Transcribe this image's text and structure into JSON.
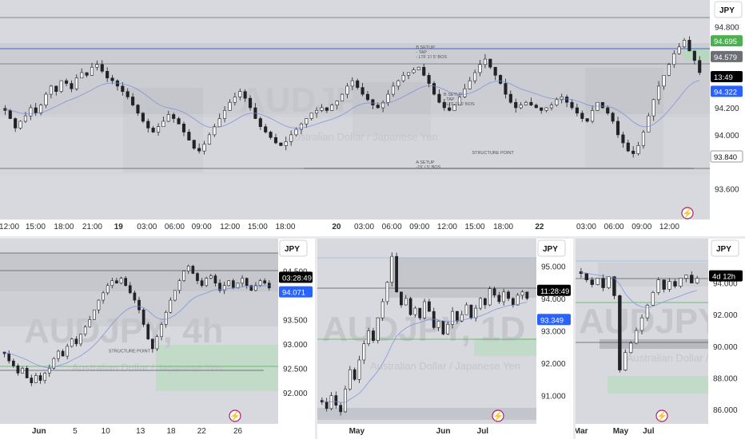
{
  "colors": {
    "up": "#ffffff",
    "down": "#202226",
    "blue_line": "#5b7bd6",
    "price_blue": "#2962ff",
    "green_tag": "#4caf50",
    "grey_tag": "#6b6e75",
    "black_tag": "#000000",
    "accent": "#b0206e",
    "green_zone": "#b9dcc0",
    "grey_zone": "#bcbec4"
  },
  "icons": [
    "lightning-icon"
  ],
  "panes": [
    {
      "id": "p1",
      "currency": "JPY",
      "watermark": "AUDJPY",
      "watermark_sub": "Australian Dollar / Japanese Yen",
      "chart_data": {
        "type": "candlestick",
        "ylim": [
          93.45,
          94.95
        ],
        "y_ticks": [
          {
            "v": 94.8,
            "t": "94.800"
          },
          {
            "v": 94.6,
            "t": "94.600"
          },
          {
            "v": 94.2,
            "t": "94.200"
          },
          {
            "v": 94.0,
            "t": "94.000"
          },
          {
            "v": 93.84,
            "t": "93.840"
          },
          {
            "v": 93.6,
            "t": "93.600"
          }
        ],
        "x_ticks": [
          {
            "x": 0.013,
            "t": "12:00"
          },
          {
            "x": 0.05,
            "t": "15:00"
          },
          {
            "x": 0.09,
            "t": "18:00"
          },
          {
            "x": 0.13,
            "t": "21:00"
          },
          {
            "x": 0.167,
            "t": "19",
            "bold": true
          },
          {
            "x": 0.207,
            "t": "03:00"
          },
          {
            "x": 0.246,
            "t": "06:00"
          },
          {
            "x": 0.284,
            "t": "09:00"
          },
          {
            "x": 0.324,
            "t": "12:00"
          },
          {
            "x": 0.363,
            "t": "15:00"
          },
          {
            "x": 0.402,
            "t": "18:00"
          },
          {
            "x": 0.474,
            "t": "20",
            "bold": true
          },
          {
            "x": 0.513,
            "t": "03:00"
          },
          {
            "x": 0.552,
            "t": "06:00"
          },
          {
            "x": 0.591,
            "t": "09:00"
          },
          {
            "x": 0.63,
            "t": "12:00"
          },
          {
            "x": 0.669,
            "t": "15:00"
          },
          {
            "x": 0.709,
            "t": "18:00"
          },
          {
            "x": 0.76,
            "t": "22",
            "bold": true
          },
          {
            "x": 0.826,
            "t": "03:00"
          },
          {
            "x": 0.865,
            "t": "06:00"
          },
          {
            "x": 0.904,
            "t": "09:00"
          },
          {
            "x": 0.943,
            "t": "12:00"
          }
        ],
        "close": [
          94.18,
          94.12,
          94.05,
          94.1,
          94.14,
          94.2,
          94.16,
          94.22,
          94.3,
          94.36,
          94.32,
          94.4,
          94.38,
          94.34,
          94.42,
          94.46,
          94.44,
          94.5,
          94.52,
          94.47,
          94.42,
          94.4,
          94.36,
          94.32,
          94.28,
          94.22,
          94.16,
          94.1,
          94.05,
          94.02,
          94.06,
          94.1,
          94.15,
          94.12,
          94.08,
          94.02,
          93.96,
          93.9,
          93.88,
          93.93,
          94.0,
          94.06,
          94.12,
          94.18,
          94.24,
          94.28,
          94.32,
          94.27,
          94.2,
          94.12,
          94.06,
          94.02,
          93.98,
          93.94,
          93.92,
          93.95,
          94.0,
          94.04,
          94.08,
          94.12,
          94.16,
          94.18,
          94.2,
          94.18,
          94.22,
          94.25,
          94.3,
          94.36,
          94.4,
          94.35,
          94.3,
          94.26,
          94.22,
          94.2,
          94.24,
          94.3,
          94.36,
          94.4,
          94.44,
          94.46,
          94.48,
          94.5,
          94.44,
          94.38,
          94.3,
          94.24,
          94.2,
          94.18,
          94.22,
          94.28,
          94.34,
          94.4,
          94.46,
          94.52,
          94.56,
          94.5,
          94.44,
          94.38,
          94.3,
          94.24,
          94.2,
          94.22,
          94.24,
          94.22,
          94.2,
          94.18,
          94.2,
          94.22,
          94.26,
          94.28,
          94.24,
          94.2,
          94.16,
          94.12,
          94.1,
          94.18,
          94.24,
          94.2,
          94.16,
          94.1,
          94.0,
          93.94,
          93.88,
          93.86,
          93.92,
          94.02,
          94.14,
          94.26,
          94.36,
          94.44,
          94.52,
          94.6,
          94.65,
          94.7,
          94.62,
          94.55,
          94.46
        ],
        "tag_prices": {
          "upper_green": 94.695,
          "current_grey": 94.579,
          "countdown": 94.43,
          "blue": 94.322,
          "support": 93.84
        },
        "tag_texts": {
          "upper_green": "94.695",
          "current_grey": "94.579",
          "countdown": "13:49",
          "blue": "94.322",
          "support": "93.840"
        },
        "annotations": [
          {
            "lines": [
              "B SETUP",
              "- TAP",
              "- LTF 1'/ 5' BOS"
            ],
            "x": 0.586,
            "y": 94.62
          },
          {
            "lines": [
              "B SETUP",
              "- TAP",
              "- LTF 1'/ 5' BOS"
            ],
            "x": 0.625,
            "y": 94.27
          },
          {
            "lines": [
              "STRUCTURE POINT"
            ],
            "x": 0.665,
            "y": 93.84
          },
          {
            "lines": [
              "A SETUP",
              "-15' / 5' BOS"
            ],
            "x": 0.586,
            "y": 93.77
          }
        ]
      }
    },
    {
      "id": "p2",
      "currency": "JPY",
      "watermark": "AUDJPY, 4h",
      "watermark_sub": "Australian Dollar / Japanese Yen",
      "chart_data": {
        "type": "candlestick",
        "ylim": [
          91.8,
          95.0
        ],
        "y_ticks": [
          {
            "v": 94.5,
            "t": "94.500"
          },
          {
            "v": 93.5,
            "t": "93.500"
          },
          {
            "v": 93.0,
            "t": "93.000"
          },
          {
            "v": 92.5,
            "t": "92.500"
          },
          {
            "v": 92.0,
            "t": "92.000"
          }
        ],
        "x_ticks": [
          {
            "x": 0.14,
            "t": "Jun",
            "bold": true
          },
          {
            "x": 0.27,
            "t": "5"
          },
          {
            "x": 0.38,
            "t": "10"
          },
          {
            "x": 0.505,
            "t": "13"
          },
          {
            "x": 0.615,
            "t": "18"
          },
          {
            "x": 0.725,
            "t": "22"
          },
          {
            "x": 0.855,
            "t": "26"
          }
        ],
        "close": [
          92.8,
          92.65,
          92.55,
          92.4,
          92.5,
          92.3,
          92.2,
          92.35,
          92.25,
          92.4,
          92.5,
          92.7,
          92.85,
          92.75,
          92.95,
          93.1,
          93.0,
          93.2,
          93.35,
          93.5,
          93.7,
          93.9,
          94.05,
          94.2,
          94.3,
          94.25,
          94.35,
          94.2,
          94.05,
          93.9,
          93.7,
          93.4,
          93.1,
          92.9,
          93.15,
          93.4,
          93.65,
          93.9,
          94.1,
          94.3,
          94.5,
          94.6,
          94.45,
          94.3,
          94.2,
          94.35,
          94.4,
          94.25,
          94.1,
          94.2,
          94.3,
          94.15,
          94.25,
          94.35,
          94.2,
          94.1,
          94.2,
          94.3,
          94.25,
          94.15
        ],
        "tag_texts": {
          "countdown": "03:28:49",
          "blue": "94.071"
        },
        "tag_prices": {
          "countdown": 94.37,
          "blue": 94.07
        },
        "annotations": [
          {
            "lines": [
              "STRUCTURE POINT"
            ],
            "x": 0.39,
            "y": 92.78
          }
        ]
      }
    },
    {
      "id": "p3",
      "currency": "JPY",
      "watermark": "AUDJPY, 1D",
      "watermark_sub": "Australian Dollar / Japanese Yen",
      "chart_data": {
        "type": "candlestick",
        "ylim": [
          90.3,
          95.6
        ],
        "y_ticks": [
          {
            "v": 95.0,
            "t": "95.000"
          },
          {
            "v": 94.0,
            "t": "94.000"
          },
          {
            "v": 93.0,
            "t": "93.000"
          },
          {
            "v": 92.0,
            "t": "92.000"
          },
          {
            "v": 91.0,
            "t": "91.000"
          }
        ],
        "x_ticks": [
          {
            "x": 0.18,
            "t": "May",
            "bold": true
          },
          {
            "x": 0.575,
            "t": "Jun",
            "bold": true
          },
          {
            "x": 0.755,
            "t": "Jul",
            "bold": true
          }
        ],
        "close": [
          90.8,
          90.6,
          91.0,
          90.7,
          90.5,
          91.2,
          91.8,
          91.5,
          92.1,
          92.6,
          93.0,
          92.7,
          93.4,
          93.9,
          94.5,
          95.3,
          94.2,
          93.8,
          94.0,
          93.5,
          93.7,
          93.4,
          93.9,
          93.6,
          93.1,
          93.3,
          92.9,
          93.2,
          93.6,
          93.3,
          93.5,
          93.8,
          93.4,
          93.7,
          94.0,
          93.8,
          94.3,
          94.1,
          93.9,
          94.2,
          94.0,
          93.8,
          94.1,
          94.2,
          94.0
        ],
        "tag_texts": {
          "countdown": "11:28:49",
          "blue": "93.349"
        },
        "tag_prices": {
          "countdown": 94.25,
          "blue": 93.35
        }
      }
    },
    {
      "id": "p4",
      "currency": "JPY",
      "watermark": "AUDJPY, 1W",
      "watermark_sub": "Australian Dollar / Japanese Yen",
      "chart_data": {
        "type": "candlestick",
        "ylim": [
          85.3,
          96.3
        ],
        "y_ticks": [
          {
            "v": 94.0,
            "t": "94.000"
          },
          {
            "v": 92.0,
            "t": "92.000"
          },
          {
            "v": 90.0,
            "t": "90.000"
          },
          {
            "v": 88.0,
            "t": "88.000"
          },
          {
            "v": 86.0,
            "t": "86.000"
          }
        ],
        "x_ticks": [
          {
            "x": 0.04,
            "t": "Mar",
            "bold": true
          },
          {
            "x": 0.34,
            "t": "May",
            "bold": true
          },
          {
            "x": 0.55,
            "t": "Jul",
            "bold": true
          }
        ],
        "close": [
          94.6,
          94.2,
          93.9,
          94.3,
          93.7,
          94.4,
          93.2,
          88.5,
          89.6,
          90.2,
          91.0,
          91.8,
          92.6,
          93.4,
          94.2,
          93.6,
          94.1,
          93.8,
          94.3,
          94.5,
          94.0,
          94.3
        ],
        "tag_texts": {
          "countdown": "4d 12h"
        },
        "tag_prices": {
          "countdown": 94.45
        }
      }
    }
  ]
}
